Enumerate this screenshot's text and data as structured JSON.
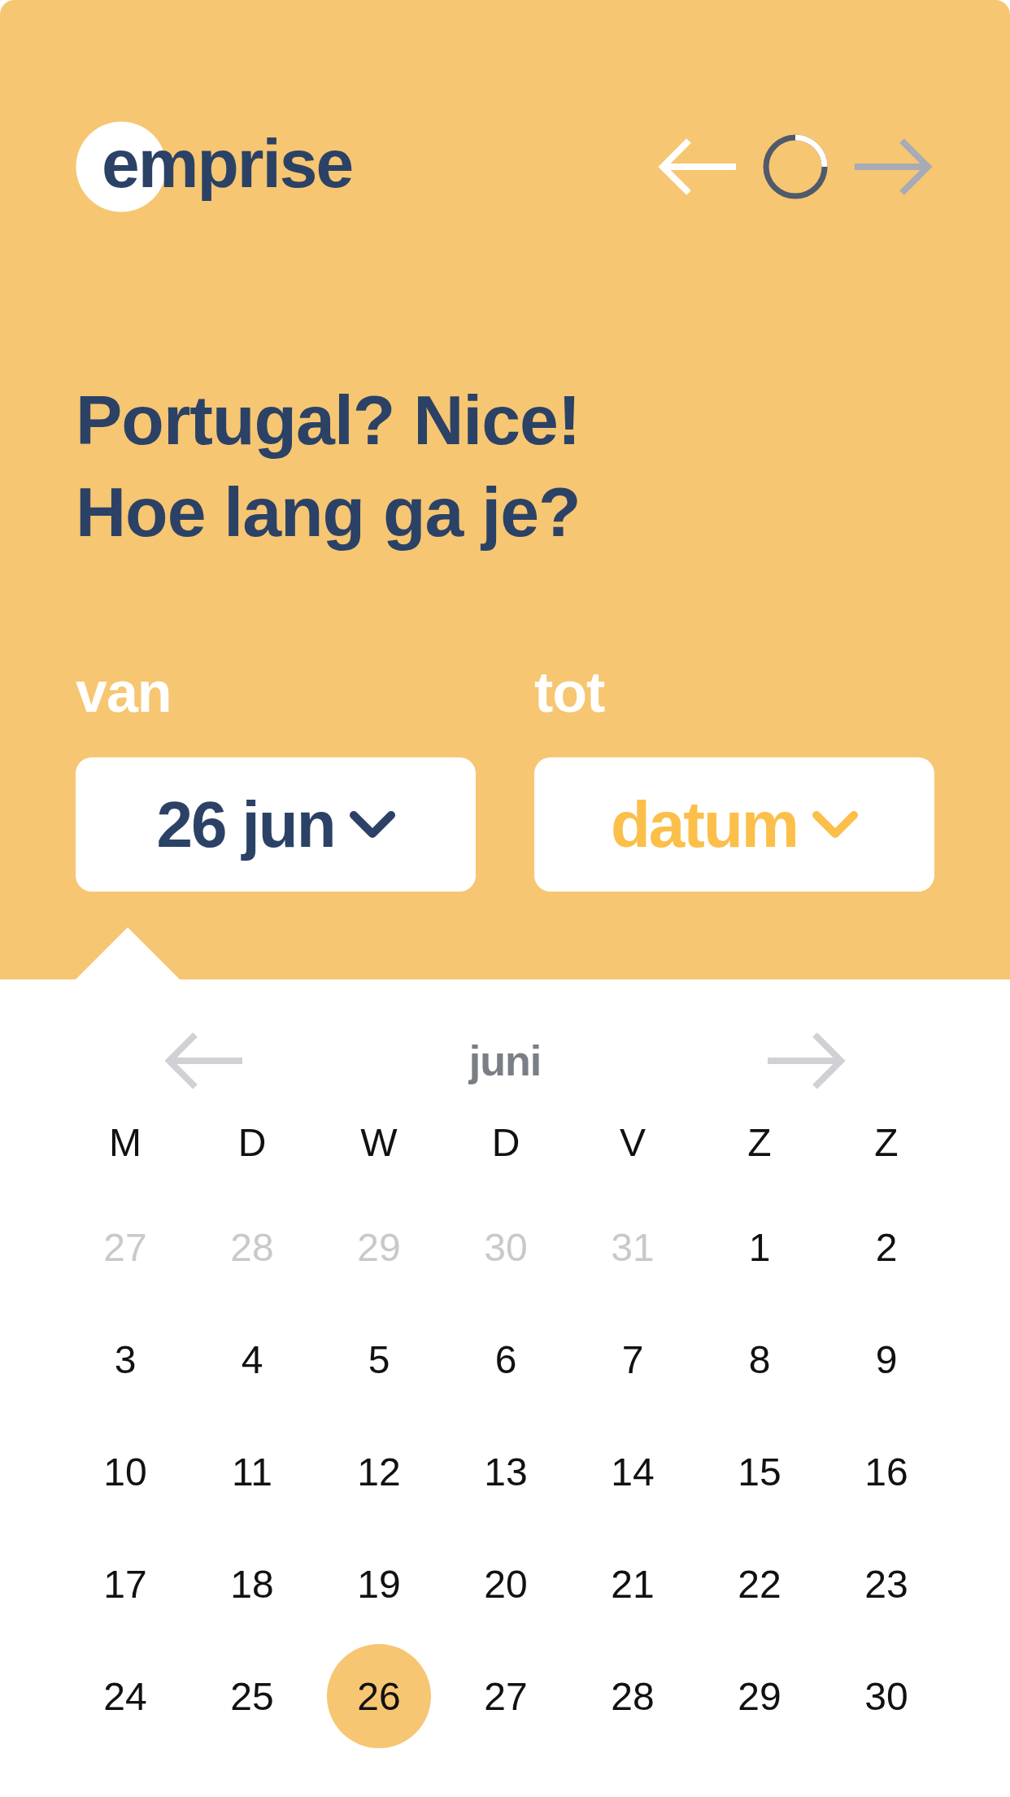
{
  "logo": "emprise",
  "nav": {
    "back": {
      "disabled": false
    },
    "progress": {
      "level": 0.25
    },
    "forward": {
      "disabled": true
    }
  },
  "heading": [
    "Portugal? Nice!",
    "Hoe lang ga je?"
  ],
  "fields": [
    {
      "label": "van",
      "value": "26 jun",
      "expanded": true
    },
    {
      "label": "tot",
      "placeholder": "datum",
      "expanded": false
    }
  ],
  "calendar": {
    "month": "juni",
    "prev": {
      "disabled": true
    },
    "next": {
      "disabled": true
    },
    "weekdays": [
      "M",
      "D",
      "W",
      "D",
      "V",
      "Z",
      "Z"
    ],
    "days": [
      {
        "label": "27",
        "muted": true,
        "selected": false
      },
      {
        "label": "28",
        "muted": true,
        "selected": false
      },
      {
        "label": "29",
        "muted": true,
        "selected": false
      },
      {
        "label": "30",
        "muted": true,
        "selected": false
      },
      {
        "label": "31",
        "muted": true,
        "selected": false
      },
      {
        "label": "1",
        "muted": false,
        "selected": false
      },
      {
        "label": "2",
        "muted": false,
        "selected": false
      },
      {
        "label": "3",
        "muted": false,
        "selected": false
      },
      {
        "label": "4",
        "muted": false,
        "selected": false
      },
      {
        "label": "5",
        "muted": false,
        "selected": false
      },
      {
        "label": "6",
        "muted": false,
        "selected": false
      },
      {
        "label": "7",
        "muted": false,
        "selected": false
      },
      {
        "label": "8",
        "muted": false,
        "selected": false
      },
      {
        "label": "9",
        "muted": false,
        "selected": false
      },
      {
        "label": "10",
        "muted": false,
        "selected": false
      },
      {
        "label": "11",
        "muted": false,
        "selected": false
      },
      {
        "label": "12",
        "muted": false,
        "selected": false
      },
      {
        "label": "13",
        "muted": false,
        "selected": false
      },
      {
        "label": "14",
        "muted": false,
        "selected": false
      },
      {
        "label": "15",
        "muted": false,
        "selected": false
      },
      {
        "label": "16",
        "muted": false,
        "selected": false
      },
      {
        "label": "17",
        "muted": false,
        "selected": false
      },
      {
        "label": "18",
        "muted": false,
        "selected": false
      },
      {
        "label": "19",
        "muted": false,
        "selected": false
      },
      {
        "label": "20",
        "muted": false,
        "selected": false
      },
      {
        "label": "21",
        "muted": false,
        "selected": false
      },
      {
        "label": "22",
        "muted": false,
        "selected": false
      },
      {
        "label": "23",
        "muted": false,
        "selected": false
      },
      {
        "label": "24",
        "muted": false,
        "selected": false
      },
      {
        "label": "25",
        "muted": false,
        "selected": false
      },
      {
        "label": "26",
        "muted": false,
        "selected": true
      },
      {
        "label": "27",
        "muted": false,
        "selected": false
      },
      {
        "label": "28",
        "muted": false,
        "selected": false
      },
      {
        "label": "29",
        "muted": false,
        "selected": false
      },
      {
        "label": "30",
        "muted": false,
        "selected": false
      }
    ]
  }
}
